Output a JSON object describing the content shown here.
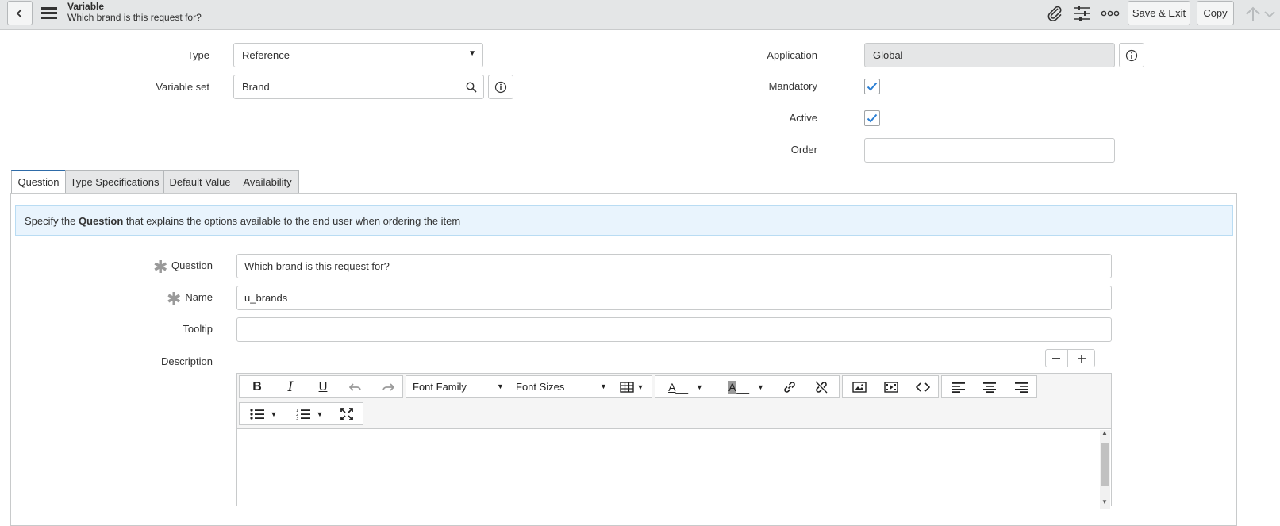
{
  "header": {
    "record_type": "Variable",
    "record_title": "Which brand is this request for?",
    "save_exit_label": "Save & Exit",
    "copy_label": "Copy",
    "icons": [
      "back-icon",
      "menu-icon",
      "paperclip-icon",
      "settings-sliders-icon",
      "more-icon",
      "up-arrow-icon",
      "chevron-down-icon"
    ]
  },
  "form": {
    "type": {
      "label": "Type",
      "value": "Reference"
    },
    "variable_set": {
      "label": "Variable set",
      "value": "Brand"
    },
    "application": {
      "label": "Application",
      "value": "Global"
    },
    "mandatory": {
      "label": "Mandatory",
      "checked": true
    },
    "active": {
      "label": "Active",
      "checked": true
    },
    "order": {
      "label": "Order",
      "value": ""
    }
  },
  "tabs": [
    {
      "label": "Question",
      "active": true
    },
    {
      "label": "Type Specifications",
      "active": false
    },
    {
      "label": "Default Value",
      "active": false
    },
    {
      "label": "Availability",
      "active": false
    }
  ],
  "question_tab": {
    "info": {
      "prefix": "Specify the ",
      "bold": "Question",
      "suffix": " that explains the options available to the end user when ordering the item"
    },
    "question": {
      "label": "Question",
      "value": "Which brand is this request for?",
      "required": true
    },
    "name": {
      "label": "Name",
      "value": "u_brands",
      "required": true
    },
    "tooltip": {
      "label": "Tooltip",
      "value": ""
    },
    "description": {
      "label": "Description"
    }
  },
  "editor": {
    "font_family_label": "Font Family",
    "font_sizes_label": "Font Sizes",
    "text_color_label": "A",
    "bg_color_label": "A"
  },
  "colors": {
    "accent": "#2e6ba8",
    "checkbox": "#2b7fd4",
    "info_bg": "#e9f4fd",
    "header_bg": "#e4e6e7"
  }
}
